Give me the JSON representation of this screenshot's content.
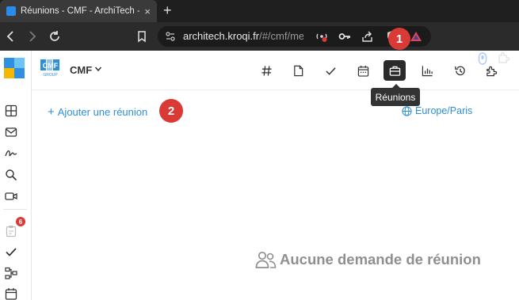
{
  "browser": {
    "tab_title": "Réunions - CMF - ArchiTech - Kr",
    "url_host": "architech.kroqi.fr",
    "url_path": "/#/cmf/me..."
  },
  "app": {
    "org_name": "CMF",
    "org_logo_text": "CMF",
    "org_logo_subtext": "GROUP",
    "header_icons": [
      "hash-icon",
      "document-icon",
      "check-icon",
      "calendar-icon",
      "briefcase-icon",
      "chart-icon",
      "history-icon",
      "puzzle-icon"
    ],
    "active_tab_tooltip": "Réunions",
    "add_meeting_label": "Ajouter une réunion",
    "add_plus": "+",
    "timezone": "Europe/Paris",
    "empty_message": "Aucune demande de réunion",
    "sidebar_badge": "6"
  },
  "annotations": {
    "step1": "1",
    "step2": "2"
  },
  "colors": {
    "accent": "#2e8fd6",
    "annotation": "#d93a36",
    "active_bg": "#2b2b2b"
  }
}
